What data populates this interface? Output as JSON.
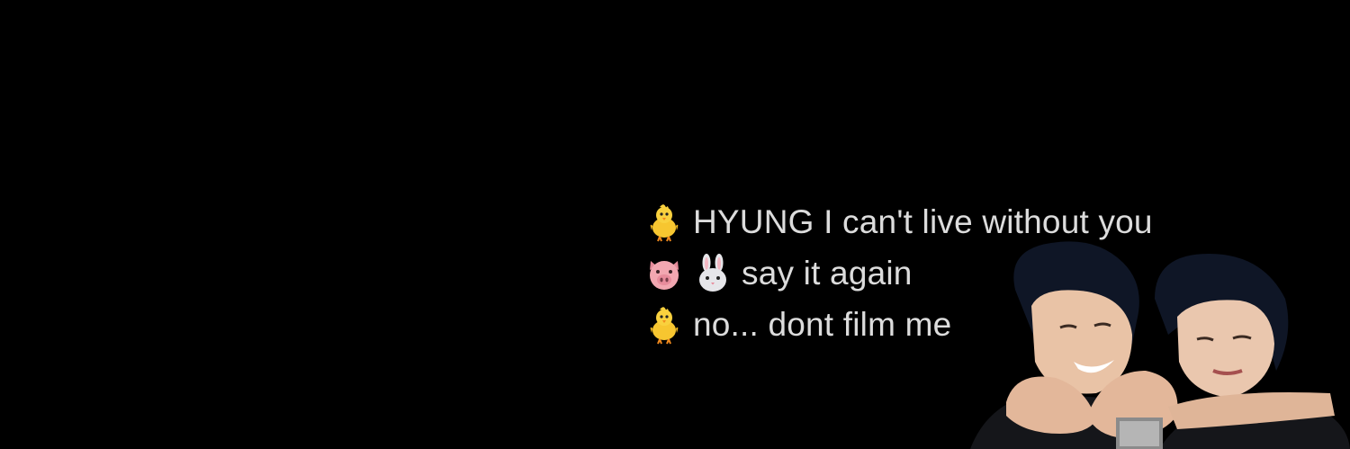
{
  "lines": [
    {
      "speaker_icons": [
        "baby-chick-icon"
      ],
      "text": "HYUNG I can't live without you"
    },
    {
      "speaker_icons": [
        "pig-face-icon",
        "rabbit-face-icon"
      ],
      "text": "say it again"
    },
    {
      "speaker_icons": [
        "baby-chick-icon"
      ],
      "text": "no... dont film me"
    }
  ],
  "colors": {
    "background": "#000000",
    "text": "#dcdcdc",
    "chick": "#f7c630",
    "pig": "#f2a7b1",
    "rabbit": "#e6e6ea"
  }
}
